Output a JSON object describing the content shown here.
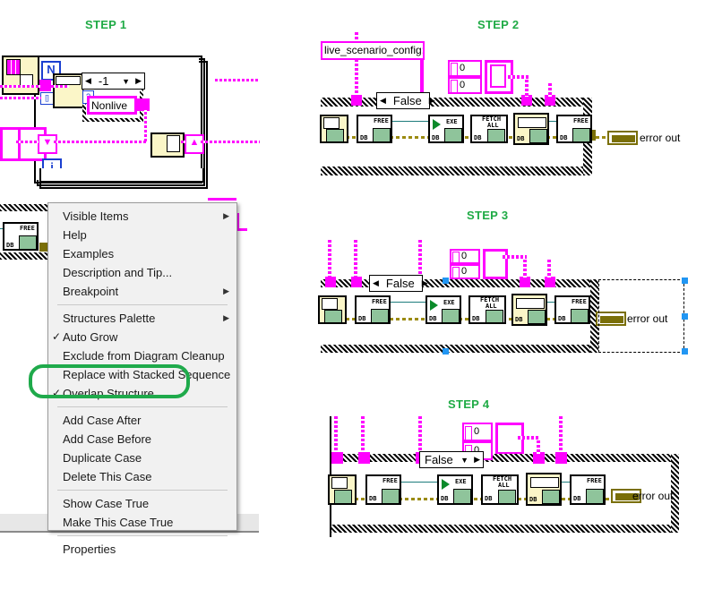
{
  "steps": [
    {
      "id": "step1",
      "label": "STEP 1"
    },
    {
      "id": "step2",
      "label": "STEP 2"
    },
    {
      "id": "step3",
      "label": "STEP 3"
    },
    {
      "id": "step4",
      "label": "STEP 4"
    }
  ],
  "colors": {
    "step_title_green": "#20ab46",
    "wire_pink": "#ff00ff",
    "error_wire_olive": "#9b8b10",
    "highlight_ring_green": "#1faa4b",
    "selection_handle_blue": "#2196f3",
    "menu_background": "#f1f1f1"
  },
  "step1": {
    "loop_count_terminal": "N",
    "iteration_terminal": "i",
    "case_selector_value": "-1",
    "case_inner_text": "Nonlive",
    "question_terminal": "?",
    "array_terminal": "[]"
  },
  "step2": {
    "string_constant": "live_scenario_config;",
    "case_selector": "False",
    "numeric_1": "0",
    "numeric_2": "0",
    "error_out_label": "error out",
    "vis": [
      {
        "name": "db-open",
        "tag": ""
      },
      {
        "name": "db-free",
        "tag": "FREE",
        "sub": "DB"
      },
      {
        "name": "db-execute",
        "tag": "EXE",
        "sub": "DB"
      },
      {
        "name": "db-fetch-all",
        "tag": "FETCH ALL",
        "sub": "DB"
      },
      {
        "name": "db-insert",
        "tag": "",
        "sub": "DB"
      },
      {
        "name": "db-free-2",
        "tag": "FREE",
        "sub": "DB"
      }
    ]
  },
  "step3": {
    "case_selector": "False",
    "numeric_1": "0",
    "numeric_2": "0",
    "error_out_label": "error out",
    "selection_active": "true"
  },
  "step4": {
    "case_selector": "False",
    "numeric_1": "0",
    "numeric_2": "0",
    "error_out_label": "error out"
  },
  "context_menu": {
    "groups": [
      {
        "items": [
          {
            "label": "Visible Items",
            "submenu": true,
            "checked": false
          },
          {
            "label": "Help",
            "submenu": false,
            "checked": false
          },
          {
            "label": "Examples",
            "submenu": false,
            "checked": false
          },
          {
            "label": "Description and Tip...",
            "submenu": false,
            "checked": false
          },
          {
            "label": "Breakpoint",
            "submenu": true,
            "checked": false
          }
        ]
      },
      {
        "items": [
          {
            "label": "Structures Palette",
            "submenu": true,
            "checked": false
          },
          {
            "label": "Auto Grow",
            "submenu": false,
            "checked": true
          },
          {
            "label": "Exclude from Diagram Cleanup",
            "submenu": false,
            "checked": false
          },
          {
            "label": "Replace with Stacked Sequence",
            "submenu": false,
            "checked": false
          },
          {
            "label": "Overlap Structure",
            "submenu": false,
            "checked": true
          }
        ]
      },
      {
        "items": [
          {
            "label": "Add Case After",
            "submenu": false,
            "checked": false
          },
          {
            "label": "Add Case Before",
            "submenu": false,
            "checked": false
          },
          {
            "label": "Duplicate Case",
            "submenu": false,
            "checked": false
          },
          {
            "label": "Delete This Case",
            "submenu": false,
            "checked": false
          }
        ]
      },
      {
        "items": [
          {
            "label": "Show Case True",
            "submenu": false,
            "checked": false
          },
          {
            "label": "Make This Case True",
            "submenu": false,
            "checked": false
          }
        ]
      },
      {
        "items": [
          {
            "label": "Properties",
            "submenu": false,
            "checked": false
          }
        ]
      }
    ],
    "highlighted_item": "Overlap Structure",
    "checkmark_glyph": "✓",
    "submenu_glyph": "▶"
  }
}
